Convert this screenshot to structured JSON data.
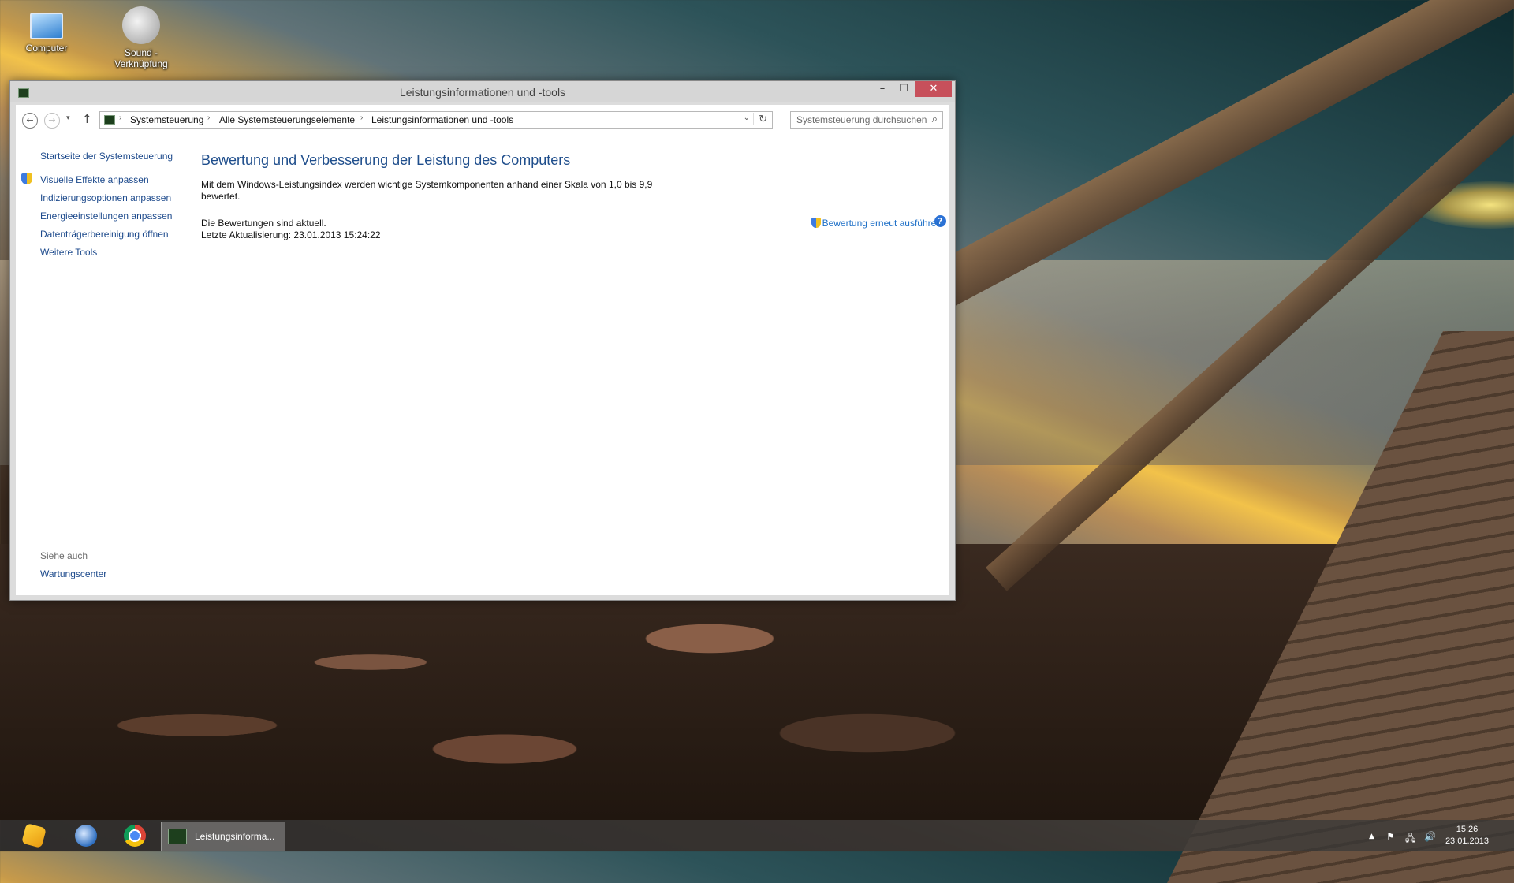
{
  "desktop": {
    "icons": [
      {
        "label": "Computer",
        "icon": "computer-icon"
      },
      {
        "label": "Sound - Verknüpfung",
        "icon": "speaker-icon"
      }
    ]
  },
  "window": {
    "title": "Leistungsinformationen und -tools",
    "controls": {
      "minimize": "–",
      "maximize": "☐",
      "close": "✕"
    },
    "nav": {
      "back": "←",
      "forward": "→",
      "recent": "▾",
      "up": "↑",
      "breadcrumb": [
        "Systemsteuerung",
        "Alle Systemsteuerungselemente",
        "Leistungsinformationen und -tools"
      ],
      "separator": "›",
      "dropdown": "⌄",
      "refresh": "↻",
      "search_placeholder": "Systemsteuerung durchsuchen",
      "search_icon": "⌕"
    },
    "left_pane": {
      "home": "Startseite der Systemsteuerung",
      "links": [
        "Visuelle Effekte anpassen",
        "Indizierungsoptionen anpassen",
        "Energieeinstellungen anpassen",
        "Datenträgerbereinigung öffnen",
        "Weitere Tools"
      ],
      "see_also_heading": "Siehe auch",
      "see_also_links": [
        "Wartungscenter"
      ]
    },
    "main": {
      "heading": "Bewertung und Verbesserung der Leistung des Computers",
      "description_line1": "Mit dem Windows-Leistungsindex werden wichtige Systemkomponenten anhand einer Skala von 1,0 bis 9,9",
      "description_line2": "bewertet.",
      "status": "Die Bewertungen sind aktuell.",
      "last_update": "Letzte Aktualisierung: 23.01.2013 15:24:22",
      "rerun_link": "Bewertung erneut ausführen",
      "help": "?"
    }
  },
  "taskbar": {
    "pinned": [
      "pyload-icon",
      "thunderbird-icon",
      "chrome-icon"
    ],
    "active_task": "Leistungsinforma...",
    "tray": {
      "arrow": "▲",
      "flag": "⚑",
      "network": "🖧",
      "volume": "🔊"
    },
    "clock": {
      "time": "15:26",
      "date": "23.01.2013"
    }
  }
}
